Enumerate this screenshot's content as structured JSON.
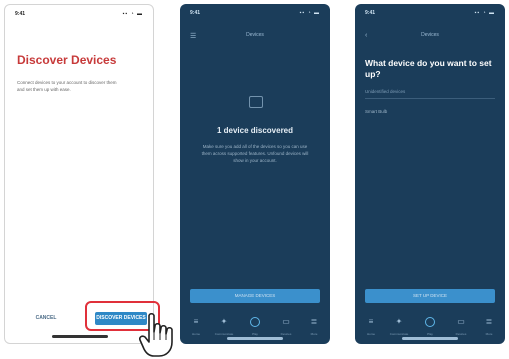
{
  "screens": [
    {
      "id": "discover",
      "status": {
        "time": "9:41",
        "icons": "▪▪ ◔ ▬"
      },
      "title": "Discover Devices",
      "description": "Connect devices to your account to discover them and set them up with ease.",
      "buttons": {
        "cancel": "CANCEL",
        "discover": "DISCOVER DEVICES"
      }
    },
    {
      "id": "discovered",
      "status": {
        "time": "9:41",
        "icons": "▪▪ ◔ ▬"
      },
      "nav": {
        "back": "☰",
        "title": "Devices"
      },
      "heading": "1 device discovered",
      "body": "Make sure you add all of the devices so you can use them across supported features. Unfound devices will show in your account.",
      "action": "MANAGE DEVICES",
      "tabs": [
        {
          "icon": "≡",
          "label": "Home"
        },
        {
          "icon": "✦",
          "label": "Communicate"
        },
        {
          "icon": "",
          "label": "Play"
        },
        {
          "icon": "▭",
          "label": "Devices"
        },
        {
          "icon": "≣",
          "label": "More"
        }
      ]
    },
    {
      "id": "what-device",
      "status": {
        "time": "9:41",
        "icons": "▪▪ ◔ ▬"
      },
      "nav": {
        "back": "‹",
        "title": "Devices"
      },
      "heading": "What device do you want to set up?",
      "category": "Unidentified devices",
      "option": "Smart Bulb",
      "action": "SET UP DEVICE",
      "tabs": [
        {
          "icon": "≡",
          "label": "Home"
        },
        {
          "icon": "✦",
          "label": "Communicate"
        },
        {
          "icon": "",
          "label": "Play"
        },
        {
          "icon": "▭",
          "label": "Devices"
        },
        {
          "icon": "≣",
          "label": "More"
        }
      ]
    }
  ],
  "colors": {
    "title_red": "#c73a3a",
    "primary_blue": "#2e88c6",
    "dark_bg": "#1b3d5a",
    "highlight_red": "#e0303a"
  }
}
